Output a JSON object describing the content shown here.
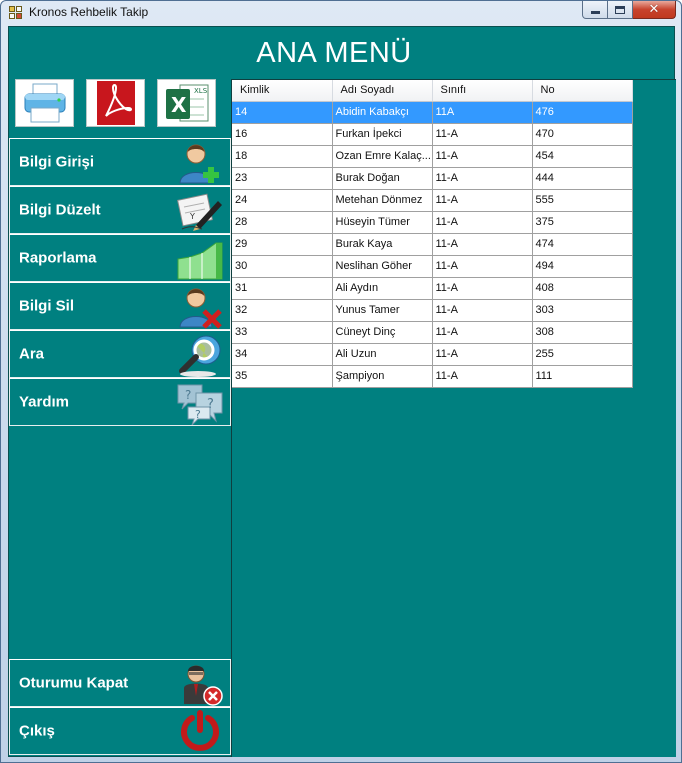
{
  "window": {
    "title": "Kronos Rehbelik Takip",
    "controls": {
      "minimize": "minimize",
      "maximize": "maximize",
      "close": "close"
    }
  },
  "page": {
    "title": "ANA MENÜ"
  },
  "export_buttons": [
    {
      "id": "print",
      "icon": "printer-icon"
    },
    {
      "id": "pdf",
      "icon": "pdf-icon",
      "color": "#c8161d"
    },
    {
      "id": "excel",
      "icon": "excel-icon",
      "color": "#1e7145"
    }
  ],
  "menu": {
    "items": [
      {
        "label": "Bilgi Girişi",
        "icon": "add-user-icon"
      },
      {
        "label": "Bilgi Düzelt",
        "icon": "edit-document-icon"
      },
      {
        "label": "Raporlama",
        "icon": "report-chart-icon"
      },
      {
        "label": "Bilgi Sil",
        "icon": "delete-user-icon"
      },
      {
        "label": "Ara",
        "icon": "search-globe-icon"
      },
      {
        "label": "Yardım",
        "icon": "help-bubbles-icon"
      }
    ],
    "bottom_items": [
      {
        "label": "Oturumu Kapat",
        "icon": "logout-user-icon"
      },
      {
        "label": "Çıkış",
        "icon": "power-icon"
      }
    ]
  },
  "grid": {
    "columns": [
      "Kimlik",
      "Adı Soyadı",
      "Sınıfı",
      "No"
    ],
    "selected_row": 0,
    "rows": [
      [
        "14",
        "Abidin Kabakçı",
        "11A",
        "476"
      ],
      [
        "16",
        "Furkan İpekci",
        "11-A",
        "470"
      ],
      [
        "18",
        "Ozan Emre Kalaç...",
        "11-A",
        "454"
      ],
      [
        "23",
        "Burak Doğan",
        "11-A",
        "444"
      ],
      [
        "24",
        "Metehan Dönmez",
        "11-A",
        "555"
      ],
      [
        "28",
        "Hüseyin Tümer",
        "11-A",
        "375"
      ],
      [
        "29",
        "Burak Kaya",
        "11-A",
        "474"
      ],
      [
        "30",
        "Neslihan Göher",
        "11-A",
        "494"
      ],
      [
        "31",
        "Ali Aydın",
        "11-A",
        "408"
      ],
      [
        "32",
        "Yunus Tamer",
        "11-A",
        "303"
      ],
      [
        "33",
        "Cüneyt Dinç",
        "11-A",
        "308"
      ],
      [
        "34",
        "Ali Uzun",
        "11-A",
        "255"
      ],
      [
        "35",
        "Şampiyon",
        "11-A",
        "111"
      ]
    ]
  },
  "colors": {
    "background": "#008080",
    "selection": "#3399ff",
    "text": "#ffffff"
  }
}
